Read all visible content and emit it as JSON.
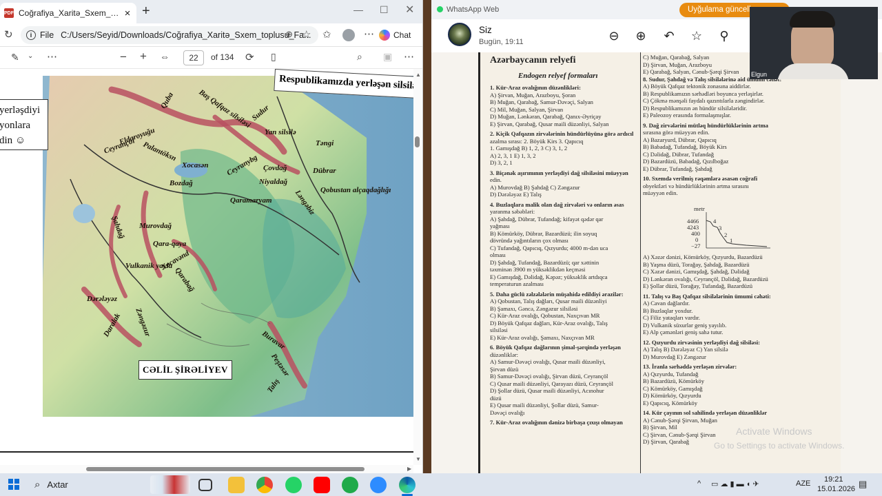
{
  "edge": {
    "tab_title": "Coğrafiya_Xaritə_Sxem_toplusu_Fa...",
    "new_tab": "+",
    "url_label": "File",
    "url": "C:/Users/Seyid/Downloads/Coğrafiya_Xaritə_Sxem_toplusu_Fa...",
    "chat_label": "Chat",
    "pdf": {
      "page_current": "22",
      "page_total": "of 134",
      "zoom_out": "−",
      "zoom_in": "+"
    },
    "map": {
      "side_box_text": [
        "yerləşdiyi",
        "yonlara",
        "din ☺"
      ],
      "title_box": "Respublikamızda yerləşən silsilə və",
      "author_box": "CƏLİL ŞİRƏLİYEV",
      "labels": [
        "Quba",
        "Baş Qafqaz silsiləsi",
        "Sudur",
        "Yan silsilə",
        "Təngi",
        "Qobustan alçaqdağlığı",
        "Dübrar",
        "Ceyrançöl",
        "Eldaroyuğu",
        "Palantöksn",
        "Xocasən",
        "Bozdağ",
        "Ceyranybg",
        "Çovdağ",
        "Niyaldağ",
        "Qaramaryam",
        "Ləngəbiz",
        "Murovdağ",
        "Qara-qaya",
        "Vulkanik yayla",
        "Xocavənd",
        "Qarabağ",
        "Dərələyəz",
        "Zəngəzur",
        "Daralak",
        "Buravar",
        "Peştəsər",
        "Talış",
        "Şahdağ"
      ]
    }
  },
  "whatsapp": {
    "window_title": "WhatsApp Web",
    "update_label": "Uyğulama güncellem...",
    "chat_name": "Siz",
    "chat_time": "Bugün, 19:11",
    "cam_name": "Elgun",
    "activate_title": "Activate Windows",
    "activate_sub": "Go to Settings to activate Windows.",
    "doc": {
      "heading": "Azərbaycanın relyefi",
      "subheading": "Endogen relyef formaları",
      "left": [
        [
          "1. Kür-Araz ovalığının düzənlikləri:",
          true
        ],
        [
          "A) Şirvan, Muğan, Arazboyu, Şoran",
          false
        ],
        [
          "B) Muğan, Qarabağ, Samur-Dəvəçi, Salyan",
          false
        ],
        [
          "C) Mil, Muğan, Salyan, Şirvan",
          false
        ],
        [
          "D) Muğan, Lənkəran, Qarabağ, Qanıx-Əyriçay",
          false
        ],
        [
          "E) Şirvan, Qarabağ, Qusar maili düzənliyi, Salyan",
          false
        ],
        [
          "",
          false
        ],
        [
          "2. Kiçik Qafqazın zirvələrinin hündürlüyünə görə ardıcıl",
          true
        ],
        [
          "   azalma sırası:   2. Böyük Kirs      3. Qapıcıq",
          false
        ],
        [
          "1. Gamışdağ        B) 1, 2, 3          C) 3, 1, 2",
          false
        ],
        [
          "A) 2, 3, 1         E) 1, 3, 2",
          false
        ],
        [
          "D) 3, 2, 1",
          false
        ],
        [
          "",
          false
        ],
        [
          "3. Biçənək aşırımının yerləşdiyi dağ silsiləsini müəyyən",
          true
        ],
        [
          "   edin.",
          false
        ],
        [
          "A) Murovdağ        B) Şahdağ         C) Zəngəzur",
          false
        ],
        [
          "D) Dərələyəz       E) Talış",
          false
        ],
        [
          "",
          false
        ],
        [
          "4. Buzlaqlara malik olan dağ zirvələri və onların əsas",
          true
        ],
        [
          "   yaranma səbəbləri:",
          false
        ],
        [
          "A) Şahdağ, Dübrar, Tufandağ; kifayət qədər qar",
          false
        ],
        [
          "   yağması",
          false
        ],
        [
          "B) Kömürköy, Dübrar, Bazardüzü; ilin soyuq",
          false
        ],
        [
          "   dövründə yağıntıların çox olması",
          false
        ],
        [
          "C) Tufandağ, Qapıcıq, Qızyurdu; 4000 m-dən uca",
          false
        ],
        [
          "   olması",
          false
        ],
        [
          "D) Şahdağ, Tufandağ, Bazardüzü; qar xəttinin",
          false
        ],
        [
          "   təxminən 3900 m yüksəklikdən keçməsi",
          false
        ],
        [
          "E) Gamışdağ, Dəlidağ, Kəpəz; yüksəklik artdıqca",
          false
        ],
        [
          "   temperaturun azalması",
          false
        ],
        [
          "",
          false
        ],
        [
          "5. Daha güclü zəlzələlərin müşahidə edildiyi ərazilər:",
          true
        ],
        [
          "A) Qobustan, Talış dağları, Qusar maili düzənliyi",
          false
        ],
        [
          "B) Şamaxı, Gəncə, Zəngəzur silsiləsi",
          false
        ],
        [
          "C) Kür-Araz ovalığı, Qobustan, Naxçıvan MR",
          false
        ],
        [
          "D) Böyük Qafqaz dağları, Kür-Araz ovalığı, Talış",
          false
        ],
        [
          "   silsiləsi",
          false
        ],
        [
          "E) Kür-Araz ovalığı, Şamaxı, Naxçıvan MR",
          false
        ],
        [
          "",
          false
        ],
        [
          "6. Böyük Qafqaz dağlarının şimal-şərqində yerləşən",
          true
        ],
        [
          "   düzənliklər:",
          false
        ],
        [
          "A) Samur-Dəvəçi ovalığı, Qusar maili düzənliyi,",
          false
        ],
        [
          "   Şirvan düzü",
          false
        ],
        [
          "B) Samur-Dəvəçi ovalığı, Şirvan düzü, Ceyrançöl",
          false
        ],
        [
          "C) Qusar maili düzənliyi, Qarayazı düzü, Ceyrançöl",
          false
        ],
        [
          "D) Şollar düzü, Qusar maili düzənliyi, Acınohur",
          false
        ],
        [
          "   düzü",
          false
        ],
        [
          "E) Qusar maili düzənliyi, Şollar düzü, Samur-",
          false
        ],
        [
          "   Dəvəçi ovalığı",
          false
        ],
        [
          "",
          false
        ],
        [
          "7. Kür-Araz ovalığının dənizə birbaşa çıxışı olmayan",
          true
        ]
      ],
      "right": [
        [
          "C) Muğan, Qarabağ, Salyan",
          false
        ],
        [
          "D) Şirvan, Muğan, Arazboyu",
          false
        ],
        [
          "E) Qarabağ, Salyan, Cənub-Şərqi Şirvan",
          false
        ],
        [
          "8. Sudur, Şahdağ və Talış silsilələrinə aid ümumi cəhət:",
          true
        ],
        [
          "A) Böyük Qafqaz tektonik zonasına aiddirlər.",
          false
        ],
        [
          "B) Respublikamızın sərhədləri boyunca yerləşirlər.",
          false
        ],
        [
          "C) Çökmə mənşəli faydalı qazıntılarla zəngindirlər.",
          false
        ],
        [
          "D) Respublikamızın ən hündür silsilələridir.",
          false
        ],
        [
          "E) Paleozoy erasında formalaşmışlar.",
          false
        ],
        [
          "",
          false
        ],
        [
          "9. Dağ zirvələrini mütləq hündürlüklərinin artma",
          true
        ],
        [
          "   sırasına görə müəyyən edin.",
          false
        ],
        [
          "A) Bazaryurd, Dübrar, Qapıcıq",
          false
        ],
        [
          "B) Babadağ, Tufandağ, Böyük Kirs",
          false
        ],
        [
          "C) Dəlidağ, Dübrar, Tufandağ",
          false
        ],
        [
          "D) Bazardüzü, Babadağ, Qızılboğaz",
          false
        ],
        [
          "E) Dübrar, Tufandağ, Şahdağ",
          false
        ],
        [
          "",
          false
        ],
        [
          "10. Sxemdə verilmiş rəqəmlərə əsasən coğrafi",
          true
        ],
        [
          "    obyektləri və hündürlüklərinin artma sırasını",
          false
        ],
        [
          "    müəyyən edin.",
          false
        ]
      ],
      "graph": {
        "unit": "metr",
        "ticks": [
          "4466",
          "4243",
          "400",
          "0",
          "−27"
        ],
        "marks": [
          "4",
          "3",
          "2",
          "1"
        ]
      },
      "right2": [
        [
          "A) Xəzər dənizi, Kömürköy, Qızyurdu, Bazardüzü",
          false
        ],
        [
          "B) Yaşma düzü, Torağay, Şahdağ, Bazardüzü",
          false
        ],
        [
          "C) Xəzər dənizi, Gamışdağ, Şahdağ, Dəlidağ",
          false
        ],
        [
          "D) Lənkəran ovalığı, Ceyrançöl, Dəlidağ, Bazardüzü",
          false
        ],
        [
          "E) Şollar düzü, Torağay, Tufandağ, Bazardüzü",
          false
        ],
        [
          "",
          false
        ],
        [
          "11. Talış və Baş Qafqaz silsilələrinin ümumi cəhəti:",
          true
        ],
        [
          "A) Cavan dağlardır.",
          false
        ],
        [
          "B) Buzlaqlar yoxdur.",
          false
        ],
        [
          "C) Filiz yataqları vardır.",
          false
        ],
        [
          "D) Vulkanik süxurlar geniş yayılıb.",
          false
        ],
        [
          "E) Alp çəmənləri geniş sahə tutur.",
          false
        ],
        [
          "",
          false
        ],
        [
          "12. Qızyurdu zirvəsinin yerləşdiyi dağ silsiləsi:",
          true
        ],
        [
          "A) Talış          B) Dərələyəz       C) Yan silsilə",
          false
        ],
        [
          "D) Murovdağ       E) Zəngəzur",
          false
        ],
        [
          "",
          false
        ],
        [
          "13. İranla sərhəddə yerləşən zirvələr:",
          true
        ],
        [
          "A) Qızyurdu, Tufandağ",
          false
        ],
        [
          "B) Bazardüzü, Kömürköy",
          false
        ],
        [
          "C) Kömürköy, Gamışdağ",
          false
        ],
        [
          "D) Kömürköy, Qızyurdu",
          false
        ],
        [
          "E) Qapıcıq, Kömürköy",
          false
        ],
        [
          "",
          false
        ],
        [
          "14. Kür çayının sol sahilində yerləşən düzənliklər",
          true
        ],
        [
          "A) Cənub-Şərqi Şirvan, Muğan",
          false
        ],
        [
          "B) Şirvan, Mil",
          false
        ],
        [
          "C) Şirvan, Cənub-Şərqi Şirvan",
          false
        ],
        [
          "D) Şirvan, Qarabağ",
          false
        ]
      ]
    }
  },
  "taskbar": {
    "search_label": "Axtar",
    "lang": "AZE",
    "time": "19:21",
    "date": "15.01.2026"
  }
}
